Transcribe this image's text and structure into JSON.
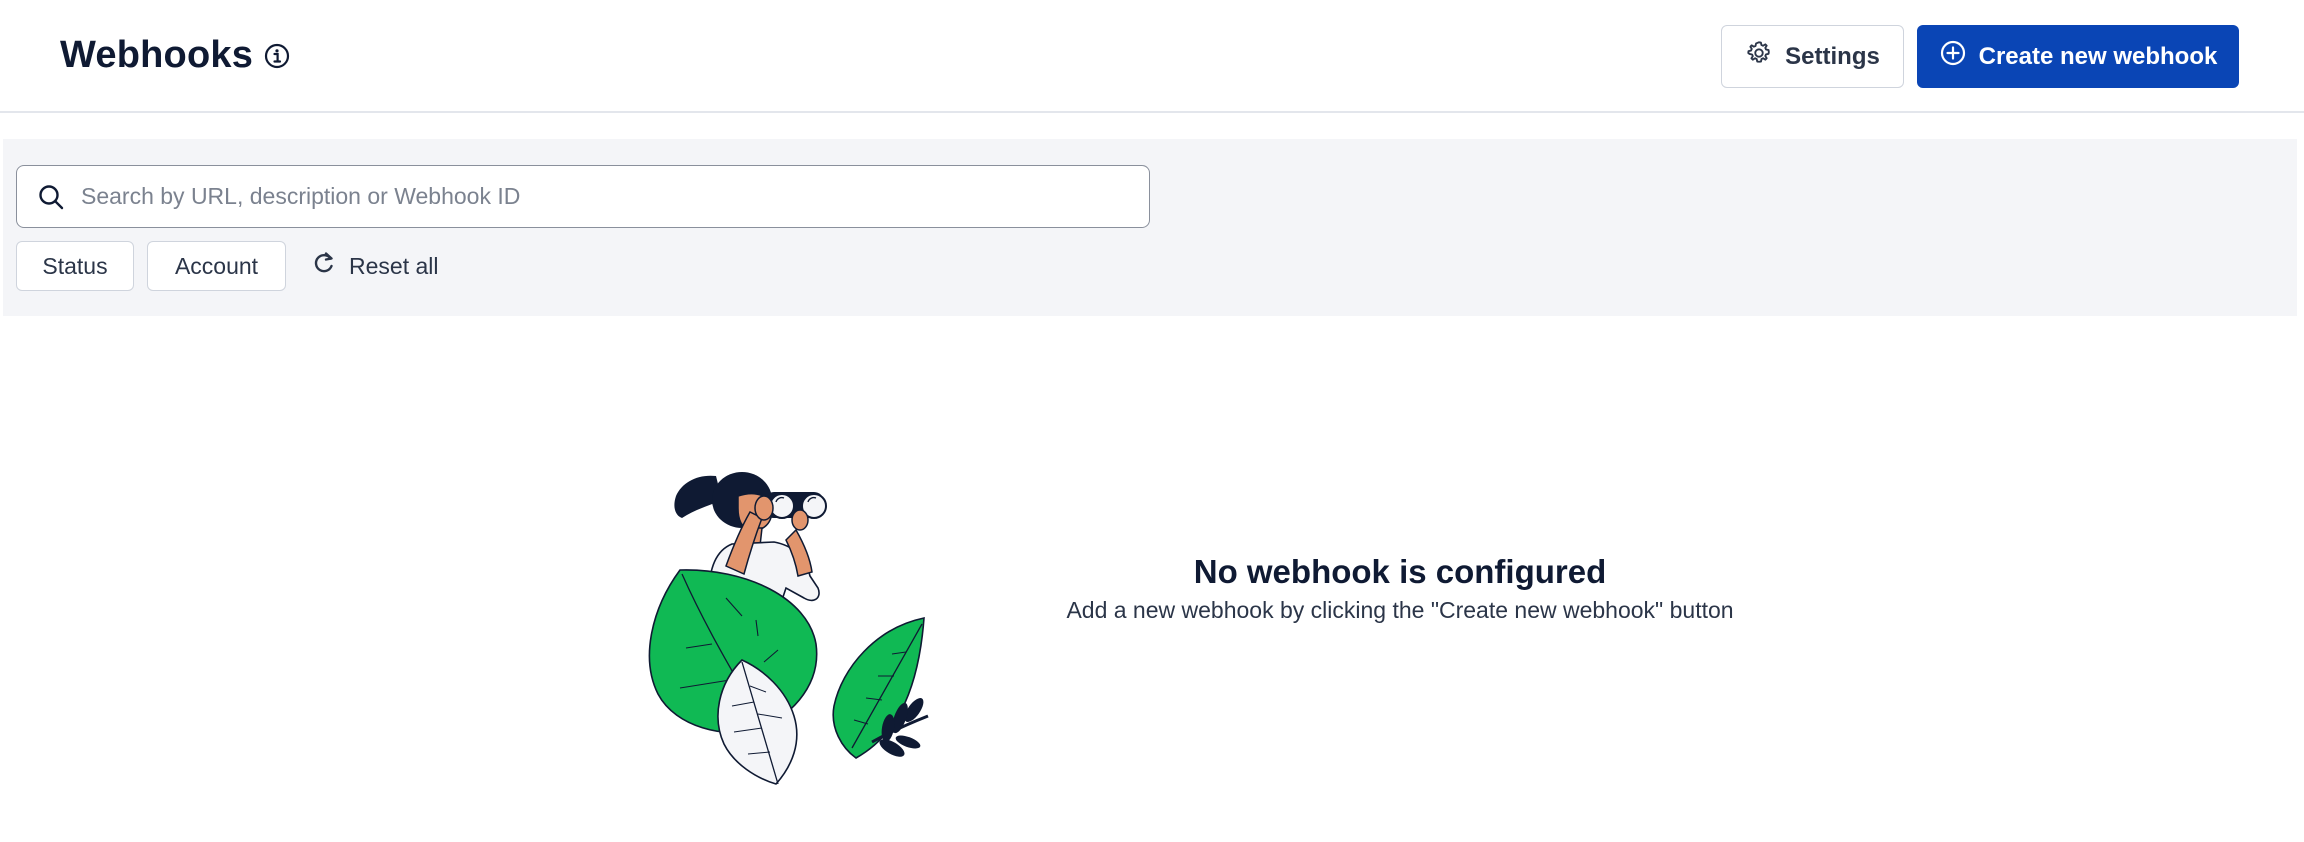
{
  "header": {
    "title": "Webhooks",
    "settings_label": "Settings",
    "create_label": "Create new webhook"
  },
  "filters": {
    "search_placeholder": "Search by URL, description or Webhook ID",
    "status_label": "Status",
    "account_label": "Account",
    "reset_label": "Reset all"
  },
  "empty_state": {
    "title": "No webhook is configured",
    "subtitle": "Add a new webhook by clicking the \"Create new webhook\" button"
  },
  "colors": {
    "primary": "#0a45b5",
    "panel_bg": "#f4f5f8",
    "leaf_green": "#10b954",
    "text_dark": "#0f1a33"
  },
  "icons": [
    "info-icon",
    "gear-icon",
    "plus-circle-icon",
    "search-icon",
    "reset-icon",
    "binoculars-illustration"
  ]
}
